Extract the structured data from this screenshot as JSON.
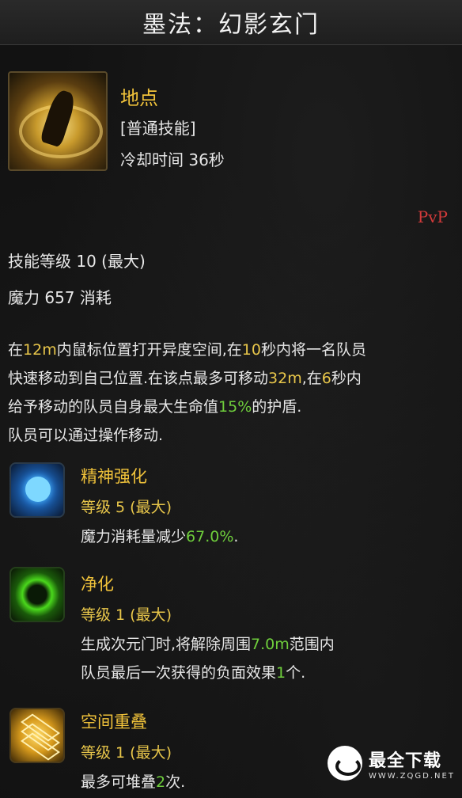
{
  "title": "墨法：幻影玄门",
  "skill": {
    "icon": "portal-caster-icon",
    "name": "地点",
    "type": "[普通技能]",
    "cooldown": "冷却时间 36秒",
    "pvp_tag": "PvP",
    "level": "技能等级 10 (最大)",
    "mana": "魔力 657 消耗"
  },
  "description": {
    "lines": [
      [
        "在",
        "12m",
        "内鼠标位置打开异度空间,在",
        "10",
        "秒内将一名队员"
      ],
      [
        "快速移动到自己位置.在该点最多可移动",
        "32m",
        ",在",
        "6",
        "秒内"
      ],
      [
        "给予移动的队员自身最大生命值",
        "15%",
        "的护盾."
      ],
      [
        "队员可以通过操作移动."
      ]
    ]
  },
  "tripods": [
    {
      "icon": "blue-flask-icon",
      "name": "精神强化",
      "level": "等级 5 (最大)",
      "desc_lines": [
        [
          "魔力消耗量减少",
          "67.0%",
          "."
        ]
      ]
    },
    {
      "icon": "green-ring-icon",
      "name": "净化",
      "level": "等级 1 (最大)",
      "desc_lines": [
        [
          "生成次元门时,将解除周围",
          "7.0m",
          "范围内"
        ],
        [
          "队员最后一次获得的负面效果",
          "1",
          "个."
        ]
      ]
    },
    {
      "icon": "stacked-layers-icon",
      "name": "空间重叠",
      "level": "等级 1 (最大)",
      "desc_lines": [
        [
          "最多可堆叠",
          "2",
          "次."
        ]
      ]
    }
  ],
  "watermark": {
    "text": "最全下载",
    "sub": "WWW.ZQGD.NET"
  },
  "colors": {
    "gold": "#f0c23a",
    "green_highlight": "#6fcf3c",
    "pvp_red": "#d23a3a"
  }
}
